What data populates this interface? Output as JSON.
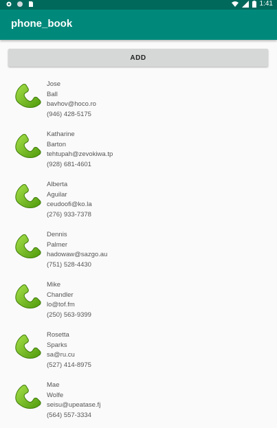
{
  "status_bar": {
    "time": "1:41",
    "left_icons": [
      "gear-icon",
      "circle-icon",
      "sim-card-icon"
    ],
    "right_icons": [
      "wifi-icon",
      "signal-icon",
      "battery-icon"
    ]
  },
  "appbar": {
    "title": "phone_book"
  },
  "add_button": {
    "label": "ADD"
  },
  "colors": {
    "status_bar": "#00695c",
    "app_bar": "#00897b",
    "phone_icon": "#7cc21a"
  },
  "contacts": [
    {
      "first": "Jose",
      "last": "Ball",
      "email": "bavhov@hoco.ro",
      "phone": "(946) 428-5175"
    },
    {
      "first": "Katharine",
      "last": "Barton",
      "email": "tehtupah@zevokiwa.tp",
      "phone": "(928) 681-4601"
    },
    {
      "first": "Alberta",
      "last": "Aguilar",
      "email": "ceudoofi@ko.la",
      "phone": "(276) 933-7378"
    },
    {
      "first": "Dennis",
      "last": "Palmer",
      "email": "hadowaw@sazgo.au",
      "phone": "(751) 528-4430"
    },
    {
      "first": "Mike",
      "last": "Chandler",
      "email": "lo@tof.fm",
      "phone": "(250) 563-9399"
    },
    {
      "first": "Rosetta",
      "last": "Sparks",
      "email": "sa@ru.cu",
      "phone": "(527) 414-8975"
    },
    {
      "first": "Mae",
      "last": "Wolfe",
      "email": "seisu@upeatase.fj",
      "phone": "(564) 557-3334"
    }
  ]
}
